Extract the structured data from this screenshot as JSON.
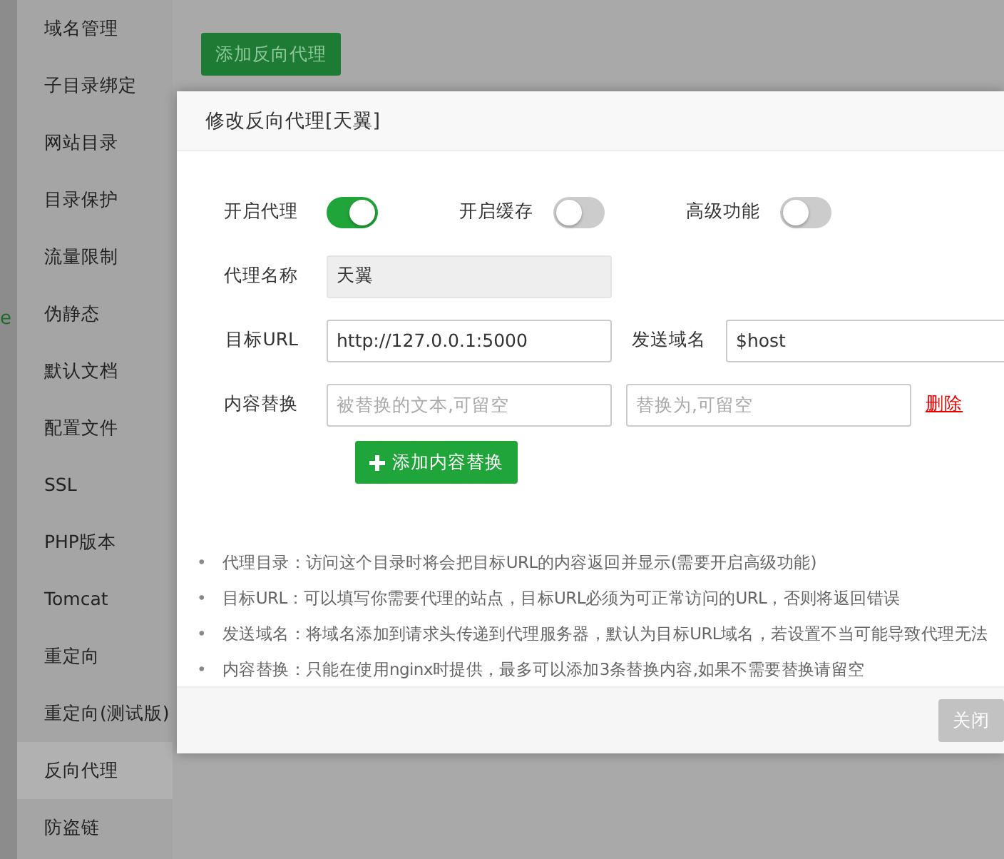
{
  "background_fragment": "e",
  "sidebar": {
    "items": [
      {
        "label": "域名管理",
        "selected": false
      },
      {
        "label": "子目录绑定",
        "selected": false
      },
      {
        "label": "网站目录",
        "selected": false
      },
      {
        "label": "目录保护",
        "selected": false
      },
      {
        "label": "流量限制",
        "selected": false
      },
      {
        "label": "伪静态",
        "selected": false
      },
      {
        "label": "默认文档",
        "selected": false
      },
      {
        "label": "配置文件",
        "selected": false
      },
      {
        "label": "SSL",
        "selected": false
      },
      {
        "label": "PHP版本",
        "selected": false
      },
      {
        "label": "Tomcat",
        "selected": false
      },
      {
        "label": "重定向",
        "selected": false
      },
      {
        "label": "重定向(测试版)",
        "selected": false
      },
      {
        "label": "反向代理",
        "selected": true
      },
      {
        "label": "防盗链",
        "selected": false
      }
    ]
  },
  "add_proxy_button": "添加反向代理",
  "modal": {
    "title": "修改反向代理[天翼]",
    "switches": [
      {
        "label": "开启代理",
        "on": true
      },
      {
        "label": "开启缓存",
        "on": false
      },
      {
        "label": "高级功能",
        "on": false
      }
    ],
    "proxy_name": {
      "label": "代理名称",
      "value": "天翼",
      "disabled": true
    },
    "target_url": {
      "label": "目标URL",
      "value": "http://127.0.0.1:5000"
    },
    "send_domain": {
      "label": "发送域名",
      "value": "$host"
    },
    "content_replace": {
      "label": "内容替换",
      "rows": [
        {
          "from_placeholder": "被替换的文本,可留空",
          "to_placeholder": "替换为,可留空",
          "delete": "删除"
        }
      ],
      "add_button": "添加内容替换"
    },
    "hints": [
      {
        "marker": "•",
        "text": "代理目录：访问这个目录时将会把目标URL的内容返回并显示(需要开启高级功能)"
      },
      {
        "marker": "•",
        "text": "目标URL：可以填写你需要代理的站点，目标URL必须为可正常访问的URL，否则将返回错误"
      },
      {
        "marker": "•",
        "text": "发送域名：将域名添加到请求头传递到代理服务器，默认为目标URL域名，若设置不当可能导致代理无法"
      },
      {
        "marker": "•",
        "text": "内容替换：只能在使用nginx时提供，最多可以添加3条替换内容,如果不需要替换请留空"
      }
    ],
    "close_button": "关闭"
  }
}
